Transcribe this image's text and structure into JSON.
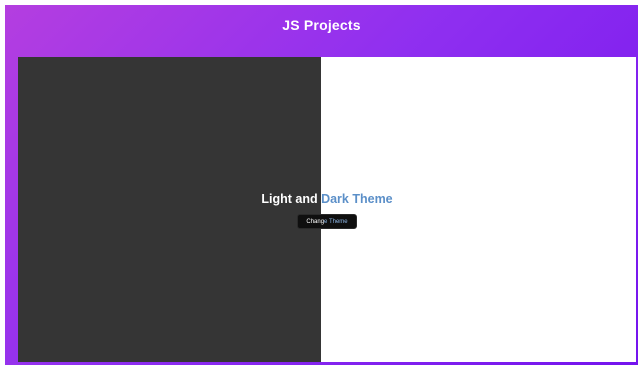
{
  "header": {
    "title": "JS Projects"
  },
  "theme_demo": {
    "heading_light_part": "Light and",
    "heading_dark_part": "Dark Theme",
    "button_label_part_a": "Chang",
    "button_label_part_b": "e Theme"
  },
  "colors": {
    "gradient_start": "#b43ee0",
    "gradient_end": "#7413ee",
    "dark_panel": "#353535",
    "light_panel": "#ffffff",
    "accent_blue": "#5b8fc8",
    "button_bg": "#0f0f0f"
  }
}
